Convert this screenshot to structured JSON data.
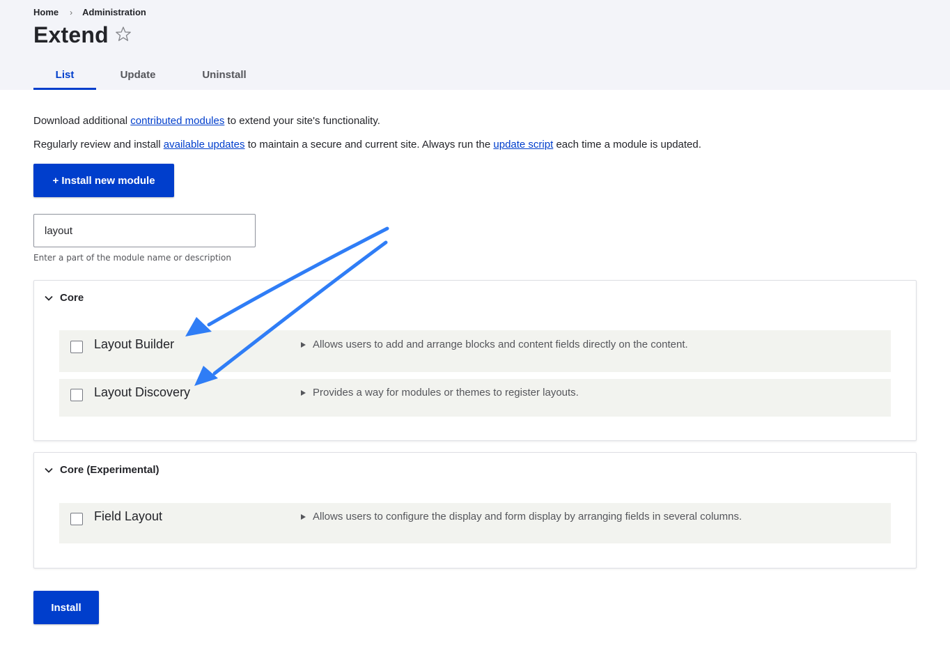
{
  "breadcrumb": {
    "home": "Home",
    "separator": "›",
    "admin": "Administration"
  },
  "page": {
    "title": "Extend"
  },
  "tabs": [
    {
      "label": "List",
      "active": true
    },
    {
      "label": "Update",
      "active": false
    },
    {
      "label": "Uninstall",
      "active": false
    }
  ],
  "intro": {
    "line1": {
      "before": "Download additional ",
      "link": "contributed modules",
      "after": " to extend your site's functionality."
    },
    "line2": {
      "before": "Regularly review and install ",
      "link1": "available updates",
      "middle": " to maintain a secure and current site. Always run the ",
      "link2": "update script",
      "after": " each time a module is updated."
    }
  },
  "actions": {
    "install_new": "+ Install new module",
    "install": "Install"
  },
  "filter": {
    "value": "layout",
    "help": "Enter a part of the module name or description"
  },
  "groups": [
    {
      "label": "Core",
      "modules": [
        {
          "name": "Layout Builder",
          "description": "Allows users to add and arrange blocks and content fields directly on the content.",
          "checked": false
        },
        {
          "name": "Layout Discovery",
          "description": "Provides a way for modules or themes to register layouts.",
          "checked": false
        }
      ]
    },
    {
      "label": "Core (Experimental)",
      "modules": [
        {
          "name": "Field Layout",
          "description": "Allows users to configure the display and form display by arranging fields in several columns.",
          "checked": false
        }
      ]
    }
  ],
  "colors": {
    "accent": "#003ecc",
    "annotation_arrow": "#2f7df6",
    "row_bg": "#f2f3ef",
    "header_bg": "#f3f4f9"
  },
  "icons": {
    "favorite": "star-outline-icon",
    "collapse": "chevron-down-icon",
    "details": "triangle-right-icon"
  }
}
